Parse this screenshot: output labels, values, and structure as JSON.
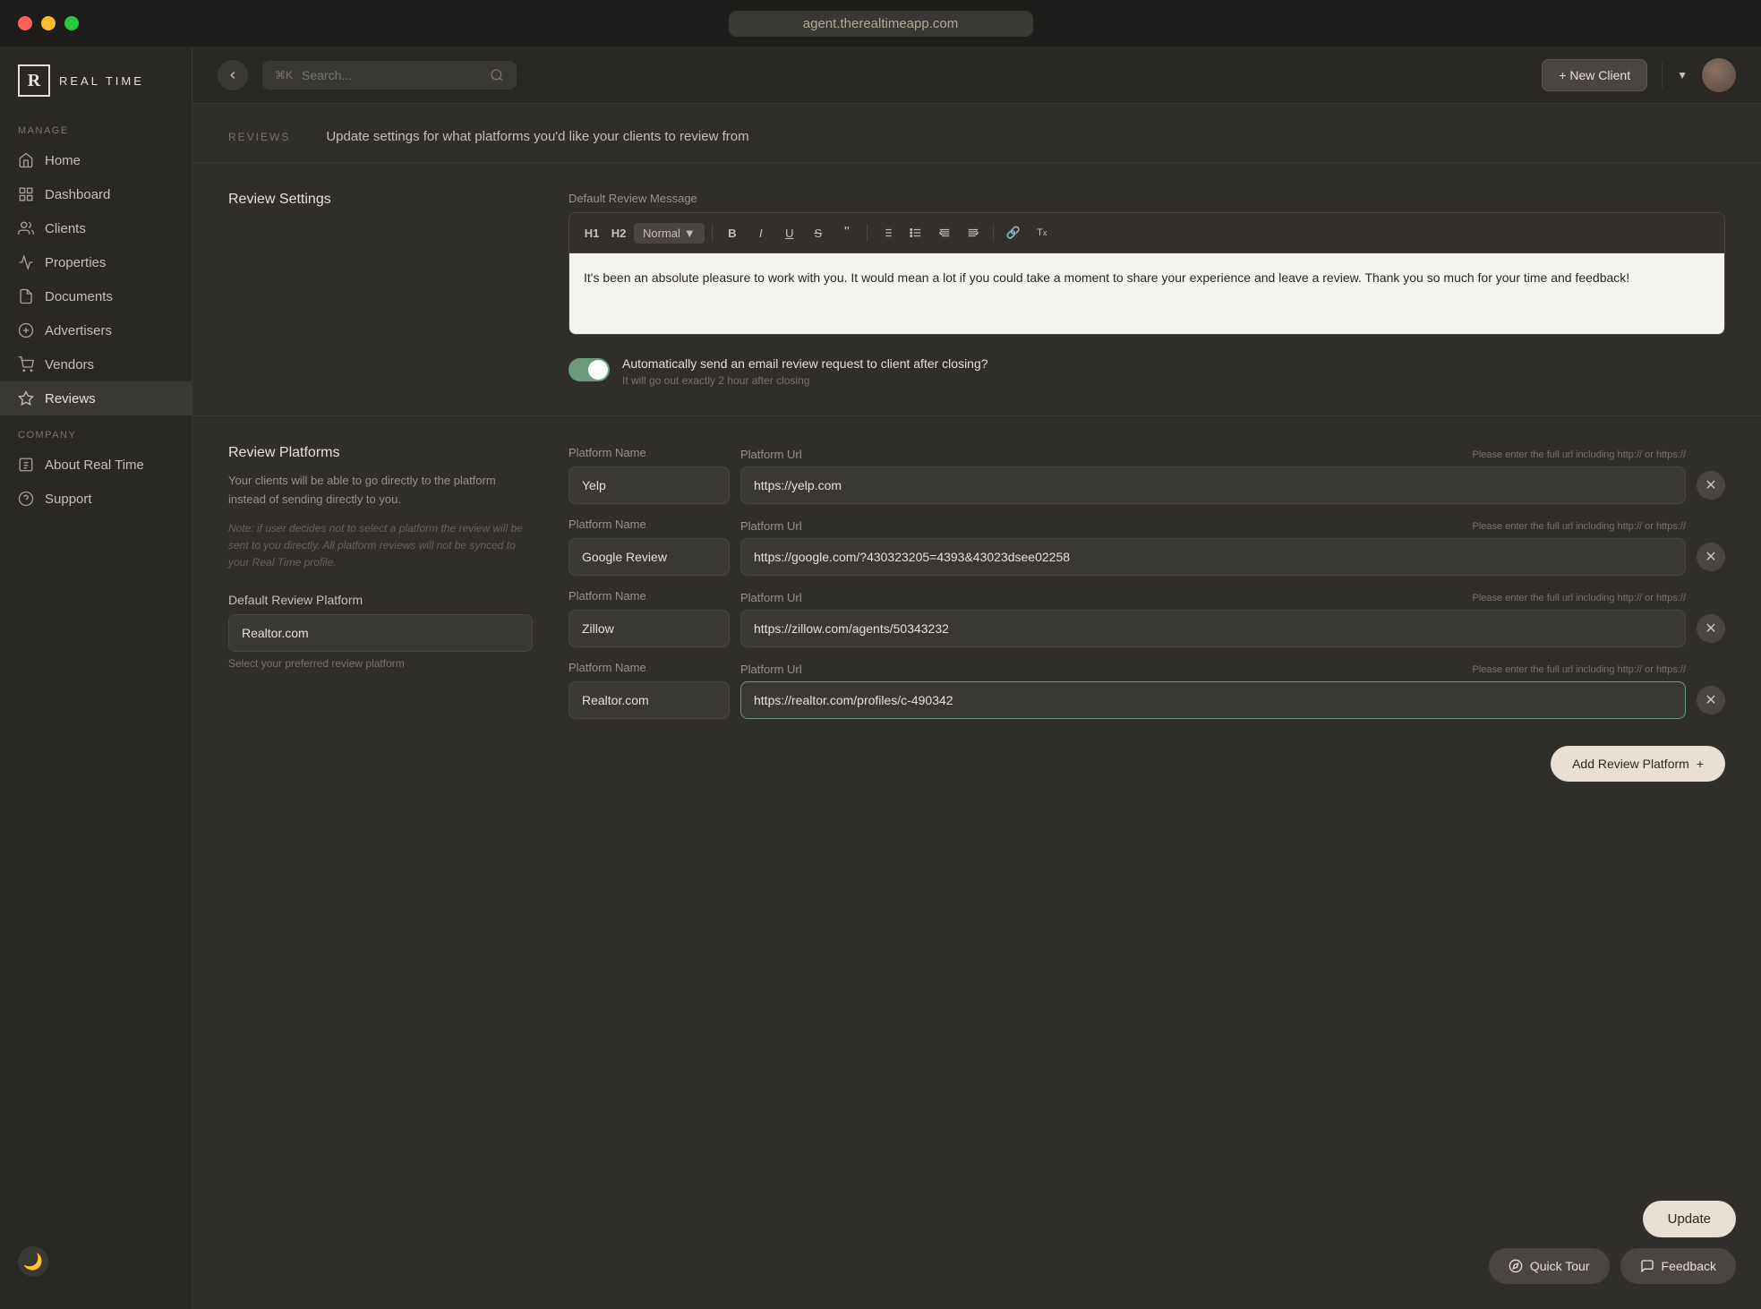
{
  "titlebar": {
    "url": "agent.therealtimeapp.com"
  },
  "topbar": {
    "search_placeholder": "Search...",
    "search_shortcut": "⌘K",
    "new_client_label": "+ New Client"
  },
  "sidebar": {
    "logo_letter": "R",
    "logo_text": "REAL TIME",
    "manage_label": "MANAGE",
    "company_label": "COMPANY",
    "nav_items": [
      {
        "label": "Home",
        "icon": "home"
      },
      {
        "label": "Dashboard",
        "icon": "dashboard"
      },
      {
        "label": "Clients",
        "icon": "clients"
      },
      {
        "label": "Properties",
        "icon": "properties"
      },
      {
        "label": "Documents",
        "icon": "documents"
      },
      {
        "label": "Advertisers",
        "icon": "advertisers"
      },
      {
        "label": "Vendors",
        "icon": "vendors"
      },
      {
        "label": "Reviews",
        "icon": "reviews",
        "active": true
      }
    ],
    "company_items": [
      {
        "label": "About Real Time",
        "icon": "about"
      },
      {
        "label": "Support",
        "icon": "support"
      }
    ]
  },
  "reviews": {
    "section_label": "REVIEWS",
    "description": "Update settings for what platforms you'd like your clients to review from",
    "settings_title": "Review Settings",
    "default_message_label": "Default Review Message",
    "message_body": "It's been an absolute pleasure to work with you. It would mean a lot if you could take a moment to share your experience and leave a review. Thank you so much for your time and feedback!",
    "toolbar": {
      "h1": "H1",
      "h2": "H2",
      "normal_label": "Normal",
      "bold": "B",
      "italic": "I",
      "underline": "U",
      "strikethrough": "S",
      "quote": "“",
      "list_ol": "OL",
      "list_ul": "UL",
      "indent_left": "←",
      "indent_right": "→",
      "link": "🔗",
      "clear_format": "Tx"
    },
    "auto_send_label": "Automatically send an email review request to client after closing?",
    "auto_send_sub": "It will go out exactly 2 hour after closing",
    "platforms_title": "Review Platforms",
    "platforms_desc": "Your clients will be able to go directly to the platform instead of sending directly to you.",
    "platforms_note": "Note: if user decides not to select a platform the review will be sent to you directly. All platform reviews will not be synced to your Real Time profile.",
    "default_platform_label": "Default Review Platform",
    "default_platform_value": "Realtor.com",
    "default_platform_hint": "Select your preferred review platform",
    "platform_name_label": "Platform Name",
    "platform_url_label": "Platform Url",
    "platform_url_hint": "Please enter the full url including http:// or https://",
    "platforms": [
      {
        "name": "Yelp",
        "url": "https://yelp.com"
      },
      {
        "name": "Google Review",
        "url": "https://google.com/?430323205=4393&43023dsee02258"
      },
      {
        "name": "Zillow",
        "url": "https://zillow.com/agents/50343232"
      },
      {
        "name": "Realtor.com",
        "url": "https://realtor.com/profiles/c-490342"
      }
    ],
    "add_platform_label": "Add Review Platform",
    "update_label": "Update",
    "quick_tour_label": "Quick Tour",
    "feedback_label": "Feedback"
  }
}
